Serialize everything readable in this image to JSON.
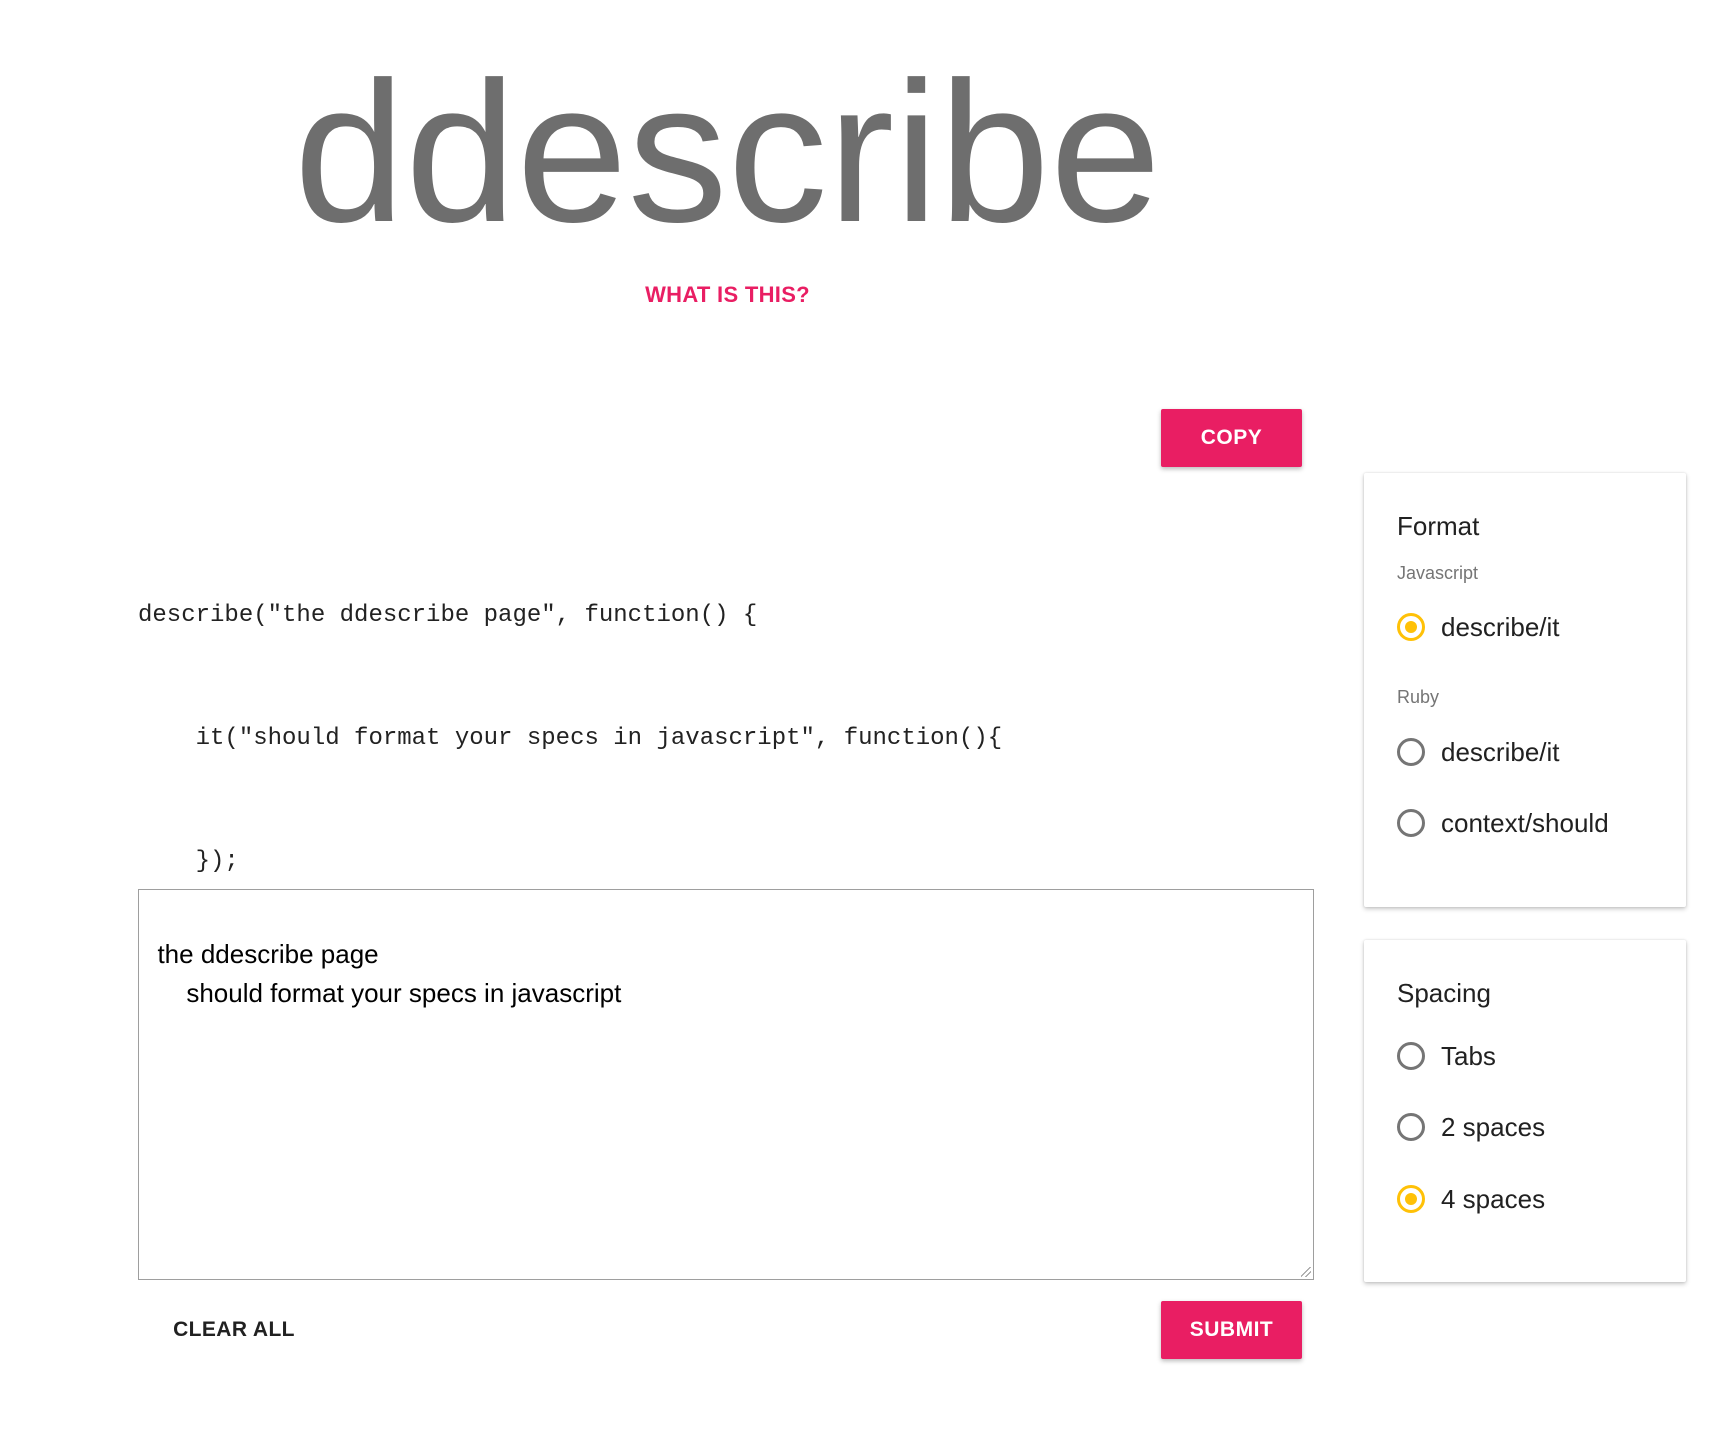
{
  "app": {
    "title": "ddescribe",
    "about_link": "WHAT IS THIS?"
  },
  "actions": {
    "copy": "COPY",
    "clear_all": "CLEAR ALL",
    "submit": "SUBMIT"
  },
  "output": {
    "lines": [
      "describe(\"the ddescribe page\", function() {",
      "    it(\"should format your specs in javascript\", function(){",
      "    });",
      "});"
    ]
  },
  "input": {
    "value": "the ddescribe page\n\tshould format your specs in javascript"
  },
  "format": {
    "title": "Format",
    "javascript_label": "Javascript",
    "ruby_label": "Ruby",
    "options": [
      {
        "group": "Javascript",
        "label": "describe/it",
        "checked": true
      },
      {
        "group": "Ruby",
        "label": "describe/it",
        "checked": false
      },
      {
        "group": "Ruby",
        "label": "context/should",
        "checked": false
      }
    ]
  },
  "spacing": {
    "title": "Spacing",
    "options": [
      {
        "label": "Tabs",
        "checked": false
      },
      {
        "label": "2 spaces",
        "checked": false
      },
      {
        "label": "4 spaces",
        "checked": true
      }
    ]
  },
  "colors": {
    "accent": "#e91e63",
    "radio_checked": "#ffc107",
    "logo_text": "#6e6e6e"
  }
}
